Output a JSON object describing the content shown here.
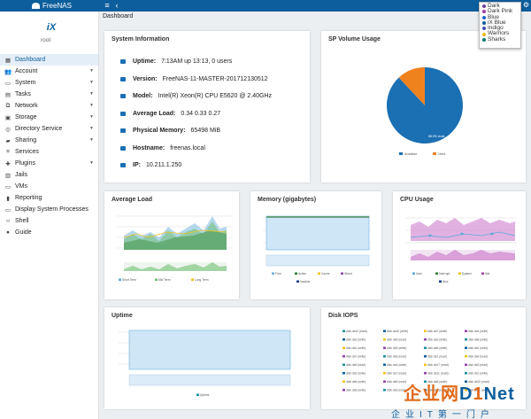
{
  "app": {
    "brand": "FreeNAS",
    "user": "root",
    "page_title": "Dashboard"
  },
  "toolbar": {
    "menu_icon": "≡",
    "collapse_icon": "‹",
    "settings_icon": "⚙"
  },
  "theme_menu": [
    {
      "label": "Dark",
      "color": "#6b3fa0"
    },
    {
      "label": "Dark Pink",
      "color": "#a23fa0"
    },
    {
      "label": "Blue",
      "color": "#1e63c8"
    },
    {
      "label": "iX Blue",
      "color": "#0d5e9c"
    },
    {
      "label": "Indigo",
      "color": "#3f51b5"
    },
    {
      "label": "Warriors",
      "color": "#f2b705"
    },
    {
      "label": "Sharks",
      "color": "#00796b"
    }
  ],
  "nav": [
    {
      "label": "Dashboard",
      "icon": "dashboard-icon",
      "glyph": "▦",
      "active": true,
      "chevron": false
    },
    {
      "label": "Account",
      "icon": "people-icon",
      "glyph": "👥",
      "chevron": true
    },
    {
      "label": "System",
      "icon": "computer-icon",
      "glyph": "▭",
      "chevron": true
    },
    {
      "label": "Tasks",
      "icon": "calendar-icon",
      "glyph": "▤",
      "chevron": true
    },
    {
      "label": "Network",
      "icon": "network-icon",
      "glyph": "⧉",
      "chevron": true
    },
    {
      "label": "Storage",
      "icon": "storage-icon",
      "glyph": "▣",
      "chevron": true
    },
    {
      "label": "Directory Service",
      "icon": "directory-icon",
      "glyph": "◎",
      "chevron": true
    },
    {
      "label": "Sharing",
      "icon": "folder-shared-icon",
      "glyph": "▰",
      "chevron": true
    },
    {
      "label": "Services",
      "icon": "tune-icon",
      "glyph": "≡",
      "chevron": false
    },
    {
      "label": "Plugins",
      "icon": "extension-icon",
      "glyph": "✚",
      "chevron": true
    },
    {
      "label": "Jails",
      "icon": "jail-icon",
      "glyph": "▥",
      "chevron": false
    },
    {
      "label": "VMs",
      "icon": "vm-icon",
      "glyph": "▭",
      "chevron": false
    },
    {
      "label": "Reporting",
      "icon": "insert-chart-icon",
      "glyph": "▮",
      "chevron": false
    },
    {
      "label": "Display System Processes",
      "icon": "processes-icon",
      "glyph": "▭",
      "chevron": false
    },
    {
      "label": "Shell",
      "icon": "code-icon",
      "glyph": "‹›",
      "chevron": false
    },
    {
      "label": "Guide",
      "icon": "info-icon",
      "glyph": "●",
      "chevron": false
    }
  ],
  "system_info": {
    "title": "System Information",
    "rows": [
      {
        "key": "Uptime:",
        "value": "7:13AM up 13:13, 0 users"
      },
      {
        "key": "Version:",
        "value": "FreeNAS-11-MASTER-201712130512"
      },
      {
        "key": "Model:",
        "value": "Intel(R) Xeon(R) CPU E5620 @ 2.40GHz"
      },
      {
        "key": "Average Load:",
        "value": "0.34 0.33 0.27"
      },
      {
        "key": "Physical Memory:",
        "value": "65498 MiB"
      },
      {
        "key": "Hostname:",
        "value": "freenas.local"
      },
      {
        "key": "IP:",
        "value": "10.211.1.250"
      }
    ]
  },
  "volume": {
    "title": "SP Volume Usage",
    "chart_data": {
      "type": "pie",
      "categories": [
        "Available",
        "Used"
      ],
      "values": [
        88,
        12
      ],
      "colors": [
        "#1b6fb3",
        "#f0821e"
      ],
      "slice_label": "88.0% Avail",
      "legend": "bottom"
    }
  },
  "avg_load": {
    "title": "Average Load",
    "legend": [
      "Short Term",
      "Mid Term",
      "Long Term"
    ],
    "colors": [
      "#5aa8d8",
      "#6fbf73",
      "#f0c419"
    ]
  },
  "memory": {
    "title": "Memory (gigabytes)",
    "legend": [
      "Free",
      "Active",
      "Cache",
      "Wired",
      "Inactive"
    ],
    "colors": [
      "#6ab0de",
      "#2e7d32",
      "#f0c419",
      "#8e44ad",
      "#1b3f8f"
    ]
  },
  "cpu": {
    "title": "CPU Usage",
    "legend": [
      "User",
      "Interrupt",
      "System",
      "Idle",
      "Nice"
    ],
    "colors": [
      "#5aa8d8",
      "#2e7d32",
      "#f0c419",
      "#a63fa0",
      "#1b3f8f"
    ]
  },
  "uptime": {
    "title": "Uptime",
    "legend": [
      "Uptime"
    ],
    "colors": [
      "#1b8f9c"
    ]
  },
  "disk_iops": {
    "title": "Disk IOPS",
    "legend": [
      "disk da10 (read)",
      "disk da10 (write)",
      "disk da7 (write)",
      "disk da4 (write)",
      "disk da2 (write)",
      "disk da5 (read)",
      "disk da3 (write)",
      "disk da8 (write)",
      "disk da1 (write)",
      "disk da9 (write)",
      "disk da6 (write)",
      "disk da2 (read)",
      "disk da7 (write)",
      "disk da6 (read)",
      "disk da1 (read)",
      "disk da4 (read)",
      "disk da9 (read)",
      "disk da4 (write)",
      "disk da17 (read)",
      "disk da3 (read)",
      "disk da2 (write)",
      "disk da7 (read)",
      "disk da11 (read)",
      "disk da1 (write)",
      "disk da6 (write)",
      "disk da6 (read)",
      "disk da8 (write)",
      "disk da10 (read)",
      "disk da5 (write)",
      "disk da3 (read)",
      "disk da8 (read)",
      "disk da11 (write)"
    ],
    "colors": [
      "#1b8f9c",
      "#0d5e9c",
      "#f0c419",
      "#8e44ad"
    ]
  },
  "watermark": {
    "line1_a": "企业网",
    "line1_b": "D",
    "line1_c": "1",
    "line1_d": "Net",
    "line2": "企业IT第一门户"
  }
}
